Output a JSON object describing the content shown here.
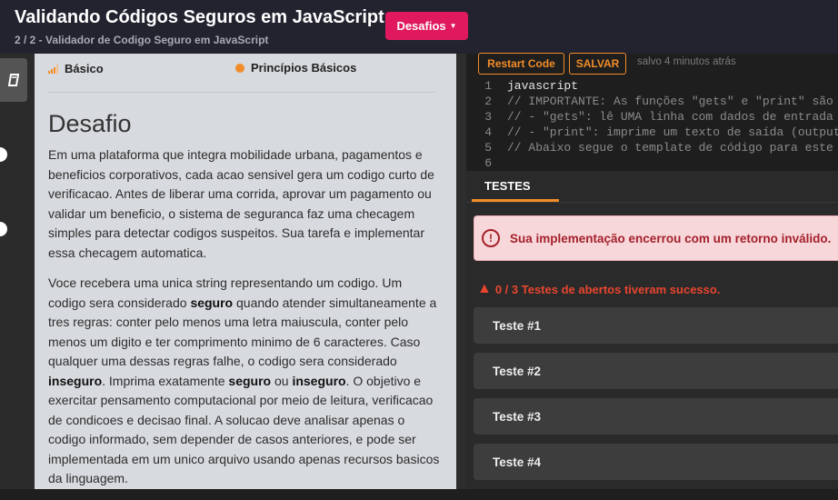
{
  "header": {
    "title": "Validando Códigos Seguros em JavaScript",
    "subtitle": "2 / 2 - Validador de Codigo Seguro em JavaScript",
    "desafios_label": "Desafios"
  },
  "sidebar": {
    "icons": [
      "edit-icon",
      "circle-icon",
      "help-icon"
    ]
  },
  "challenge": {
    "level": "Básico",
    "category": "Princípios Básicos",
    "heading": "Desafio",
    "p1": "Em uma plataforma que integra mobilidade urbana, pagamentos e beneficios corporativos, cada acao sensivel gera um codigo curto de verificacao. Antes de liberar uma corrida, aprovar um pagamento ou validar um beneficio, o sistema de seguranca faz uma checagem simples para detectar codigos suspeitos. Sua tarefa e implementar essa checagem automatica.",
    "p2": {
      "t1": "Voce recebera uma unica string representando um codigo. Um codigo sera considerado ",
      "b1": "seguro",
      "t2": " quando atender simultaneamente a tres regras: conter pelo menos uma letra maiuscula, conter pelo menos um digito e ter comprimento minimo de 6 caracteres. Caso qualquer uma dessas regras falhe, o codigo sera considerado ",
      "b2": "inseguro",
      "t3": ". Imprima exatamente ",
      "b3": "seguro",
      "t4": " ou ",
      "b4": "inseguro",
      "t5": ". O objetivo e exercitar pensamento computacional por meio de leitura, verificacao de condicoes e decisao final. A solucao deve analisar apenas o codigo informado, sem depender de casos anteriores, e pode ser implementada em um unico arquivo usando apenas recursos basicos da linguagem."
    }
  },
  "editor": {
    "restart_label": "Restart Code",
    "save_label": "SALVAR",
    "saved_text": "salvo 4 minutos atrás",
    "lines": [
      {
        "n": "1",
        "text": "javascript",
        "kind": "plain"
      },
      {
        "n": "2",
        "text": "// IMPORTANTE: As funções \"gets\" e \"print\" são a",
        "kind": "comment"
      },
      {
        "n": "3",
        "text": "// - \"gets\": lê UMA linha com dados de entrada",
        "kind": "comment"
      },
      {
        "n": "4",
        "text": "// - \"print\": imprime um texto de saída (output",
        "kind": "comment"
      },
      {
        "n": "5",
        "text": "// Abaixo segue o template de código para este d",
        "kind": "comment"
      },
      {
        "n": "6",
        "text": "",
        "kind": "plain"
      }
    ]
  },
  "tests": {
    "tab_label": "TESTES",
    "alert_text": "Sua implementação encerrou com um retorno inválido.",
    "summary": "0 / 3 Testes de abertos tiveram sucesso.",
    "items": [
      "Teste #1",
      "Teste #2",
      "Teste #3",
      "Teste #4"
    ]
  },
  "colors": {
    "accent": "#e0195e",
    "orange": "#f28c28",
    "error": "#a3212b"
  }
}
